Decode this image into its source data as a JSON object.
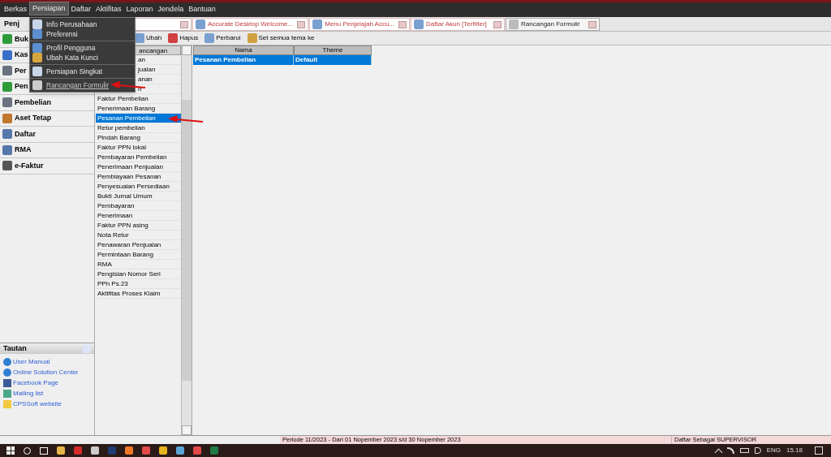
{
  "menu_bar": [
    {
      "label": "Berkas",
      "selected": false
    },
    {
      "label": "Persiapan",
      "selected": true
    },
    {
      "label": "Daftar",
      "selected": false
    },
    {
      "label": "Aktifitas",
      "selected": false
    },
    {
      "label": "Laporan",
      "selected": false
    },
    {
      "label": "Jendela",
      "selected": false
    },
    {
      "label": "Bantuan",
      "selected": false
    }
  ],
  "dropdown": [
    {
      "label": "Info Perusahaan",
      "highlighted": false,
      "annotated": false
    },
    {
      "label": "Preferensi",
      "highlighted": false,
      "annotated": false
    },
    {
      "label": "Profil Pengguna",
      "highlighted": false,
      "annotated": false
    },
    {
      "label": "Ubah Kata Kunci",
      "highlighted": false,
      "annotated": false
    },
    {
      "label": "Persiapan Singkat",
      "highlighted": false,
      "annotated": false
    },
    {
      "label": "Rancangan Formulir",
      "highlighted": true,
      "annotated": true
    }
  ],
  "tabs": [
    {
      "label": "Accurate Desktop Welcome...",
      "selected": false
    },
    {
      "label": "Menu Penjelajah Accu...",
      "selected": false
    },
    {
      "label": "Daftar Akun [Terfilter]",
      "selected": false
    },
    {
      "label": "Rancangan Formulir",
      "selected": true
    }
  ],
  "sidebar": {
    "header": "Penj",
    "items": [
      {
        "label": "Buk"
      },
      {
        "label": "Kas"
      },
      {
        "label": "Per"
      },
      {
        "label": "Pen"
      },
      {
        "label": "Pembelian"
      },
      {
        "label": "Aset Tetap"
      },
      {
        "label": "Daftar"
      },
      {
        "label": "RMA"
      },
      {
        "label": "e-Faktur"
      }
    ]
  },
  "links": {
    "title": "Tautan",
    "items": [
      "User Manual",
      "Online Solution Center",
      "Facebook Page",
      "Mailing list",
      "CPSSoft website"
    ]
  },
  "toolbar": [
    "Ubah",
    "Hapus",
    "Perbarui",
    "Set semua tema ke"
  ],
  "form_list": {
    "header": "ancangan",
    "items": [
      {
        "label": "an",
        "kind": "partial",
        "selected": false
      },
      {
        "label": "jualan",
        "kind": "partial",
        "selected": false
      },
      {
        "label": "anan",
        "kind": "partial",
        "selected": false
      },
      {
        "label": "n",
        "kind": "partial",
        "selected": false
      },
      {
        "label": "Faktur Pembelian",
        "kind": "full",
        "selected": false
      },
      {
        "label": "Penerimaan Barang",
        "kind": "full",
        "selected": false
      },
      {
        "label": "Pesanan Pembelian",
        "kind": "full",
        "selected": true
      },
      {
        "label": "Retur pembelian",
        "kind": "full",
        "selected": false
      },
      {
        "label": "Pindah Barang",
        "kind": "full",
        "selected": false
      },
      {
        "label": "Faktur PPN lokal",
        "kind": "full",
        "selected": false
      },
      {
        "label": "Pembayaran Pembelian",
        "kind": "full",
        "selected": false
      },
      {
        "label": "Penerimaan Penjualan",
        "kind": "full",
        "selected": false
      },
      {
        "label": "Pembiayaan Pesanan",
        "kind": "full",
        "selected": false
      },
      {
        "label": "Penyesuaian Persediaan",
        "kind": "full",
        "selected": false
      },
      {
        "label": "Bukti Jurnal Umum",
        "kind": "full",
        "selected": false
      },
      {
        "label": "Pembayaran",
        "kind": "full",
        "selected": false
      },
      {
        "label": "Penerimaan",
        "kind": "full",
        "selected": false
      },
      {
        "label": "Faktur PPN asing",
        "kind": "full",
        "selected": false
      },
      {
        "label": "Nota Retur",
        "kind": "full",
        "selected": false
      },
      {
        "label": "Penawaran Penjualan",
        "kind": "full",
        "selected": false
      },
      {
        "label": "Permintaan Barang",
        "kind": "full",
        "selected": false
      },
      {
        "label": "RMA",
        "kind": "full",
        "selected": false
      },
      {
        "label": "Pengisian Nomor Seri",
        "kind": "full",
        "selected": false
      },
      {
        "label": "PPh Ps.23",
        "kind": "full",
        "selected": false
      },
      {
        "label": "Aktifitas Proses Klaim",
        "kind": "full",
        "selected": false
      }
    ]
  },
  "theme_table": {
    "columns": [
      "Nama",
      "Theme"
    ],
    "rows": [
      {
        "cells": [
          "Pesanan Pembelian",
          "Default"
        ],
        "selected": true
      }
    ]
  },
  "status_bar": {
    "period": "Periode 11/2023 - Dari 01 Nopember 2023 s/d 30 Nopember 2023",
    "user": "Daftar Sebagai SUPERVISOR"
  },
  "taskbar": {
    "language": "ENG",
    "time": "15.18"
  }
}
